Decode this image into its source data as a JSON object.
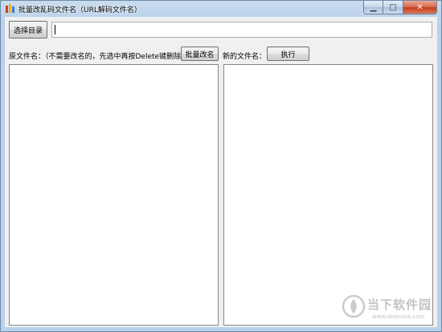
{
  "window": {
    "title": "批量改乱码文件名（URL解码文件名）",
    "icon": "app-icon",
    "caption_buttons": {
      "minimize_icon": "minimize-icon",
      "maximize_icon": "maximize-icon",
      "close_icon": "close-icon",
      "minimize_glyph": "▁",
      "maximize_glyph": "□",
      "close_glyph": "✕"
    }
  },
  "toolbar": {
    "select_dir_label": "选择目录",
    "dir_value": ""
  },
  "original_panel": {
    "label": "原文件名：（不需要改名的，先选中再按Delete键删除）",
    "batch_rename_label": "批量改名",
    "items": []
  },
  "new_panel": {
    "label": "新的文件名：",
    "execute_label": "执行",
    "items": []
  },
  "watermark": {
    "brand": "当下软件园",
    "url": "www.downxia.com"
  },
  "colors": {
    "titlebar": "#b9d1ea",
    "client_bg": "#f0f0f0",
    "close_button": "#c43b1c"
  }
}
